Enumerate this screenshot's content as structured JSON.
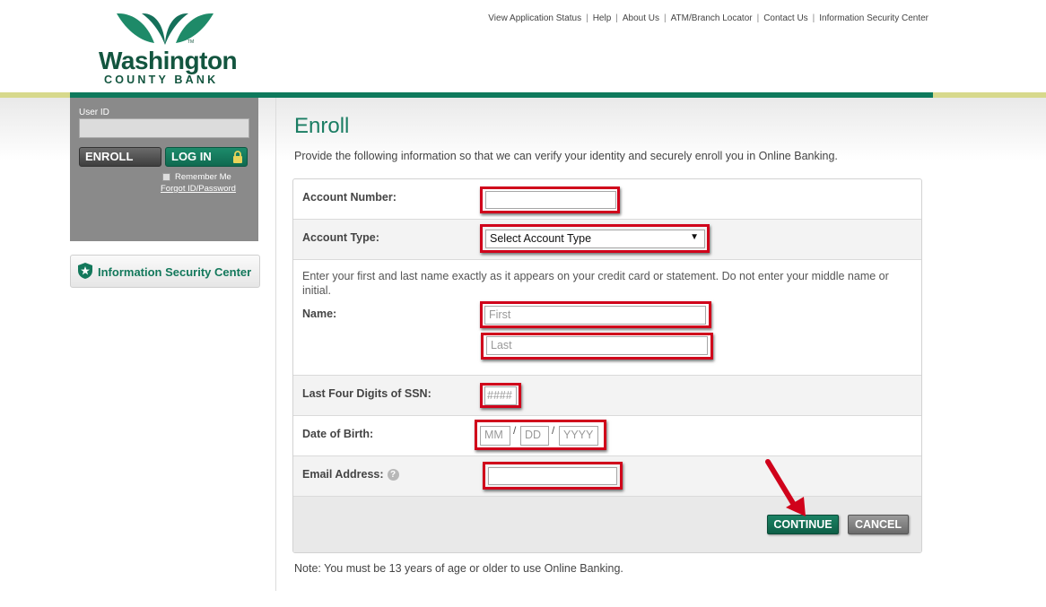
{
  "brand": {
    "name": "Washington",
    "sub": "COUNTY BANK",
    "tm": "TM",
    "green": "#13553f",
    "accent": "#0e7a5c"
  },
  "top_links": [
    "View Application Status",
    "Help",
    "About Us",
    "ATM/Branch Locator",
    "Contact Us",
    "Information Security Center"
  ],
  "sidebar": {
    "user_id_label": "User ID",
    "enroll_label": "ENROLL",
    "login_label": "LOG IN",
    "remember_label": "Remember Me",
    "forgot_label": "Forgot ID/Password",
    "isc_label": "Information Security Center"
  },
  "main": {
    "title": "Enroll",
    "intro": "Provide the following information so that we can verify your identity and securely enroll you in Online Banking.",
    "note": "Note: You must be 13 years of age or older to use Online Banking."
  },
  "form": {
    "account_number_label": "Account Number:",
    "account_type_label": "Account Type:",
    "account_type_value": "Select Account Type",
    "name_instructions": "Enter your first and last name exactly as it appears on your credit card or statement. Do not enter your middle name or initial.",
    "name_label": "Name:",
    "first_placeholder": "First",
    "last_placeholder": "Last",
    "ssn_label": "Last Four Digits of SSN:",
    "ssn_placeholder": "####",
    "dob_label": "Date of Birth:",
    "dob_mm": "MM",
    "dob_dd": "DD",
    "dob_yyyy": "YYYY",
    "dob_sep": "/",
    "email_label": "Email Address:",
    "help_glyph": "?",
    "continue_label": "CONTINUE",
    "cancel_label": "CANCEL",
    "highlight_color": "#d0021b"
  }
}
